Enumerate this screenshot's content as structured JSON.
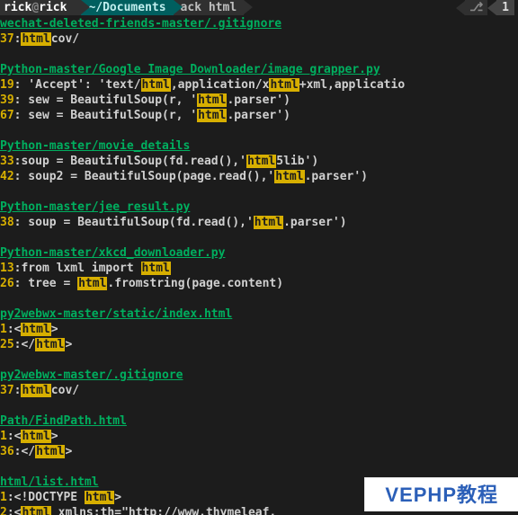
{
  "prompt": {
    "user": "rick",
    "at": "@",
    "host": "rick",
    "path": "~/Documents",
    "command": "ack html",
    "right_num": "1"
  },
  "groups": [
    {
      "file": "wechat-deleted-friends-master/.gitignore",
      "lines": [
        {
          "ln": "37",
          "pre": "",
          "hl": "html",
          "post": "cov/"
        }
      ]
    },
    {
      "file": "Python-master/Google Image Downloader/image grapper.py",
      "lines": [
        {
          "ln": "19",
          "segments": [
            "        'Accept': 'text/",
            {
              "hl": "html"
            },
            ",application/x",
            {
              "hl": "html"
            },
            "+xml,applicatio"
          ]
        },
        {
          "ln": "39",
          "segments": [
            "        sew = BeautifulSoup(r, '",
            {
              "hl": "html"
            },
            ".parser')"
          ]
        },
        {
          "ln": "67",
          "segments": [
            "        sew = BeautifulSoup(r, '",
            {
              "hl": "html"
            },
            ".parser')"
          ]
        }
      ]
    },
    {
      "file": "Python-master/movie_details",
      "lines": [
        {
          "ln": "33",
          "segments": [
            "soup = BeautifulSoup(fd.read(),'",
            {
              "hl": "html"
            },
            "5lib')"
          ]
        },
        {
          "ln": "42",
          "segments": [
            "    soup2 = BeautifulSoup(page.read(),'",
            {
              "hl": "html"
            },
            ".parser')"
          ]
        }
      ]
    },
    {
      "file": "Python-master/jee_result.py",
      "lines": [
        {
          "ln": "38",
          "segments": [
            "    soup = BeautifulSoup(fd.read(),'",
            {
              "hl": "html"
            },
            ".parser')"
          ]
        }
      ]
    },
    {
      "file": "Python-master/xkcd_downloader.py",
      "lines": [
        {
          "ln": "13",
          "segments": [
            "from lxml import ",
            {
              "hl": "html"
            }
          ]
        },
        {
          "ln": "26",
          "segments": [
            "    tree = ",
            {
              "hl": "html"
            },
            ".fromstring(page.content)"
          ]
        }
      ]
    },
    {
      "file": "py2webwx-master/static/index.html",
      "lines": [
        {
          "ln": "1",
          "segments": [
            "<",
            {
              "hl": "html"
            },
            ">"
          ]
        },
        {
          "ln": "25",
          "segments": [
            "</",
            {
              "hl": "html"
            },
            ">"
          ]
        }
      ]
    },
    {
      "file": "py2webwx-master/.gitignore",
      "lines": [
        {
          "ln": "37",
          "segments": [
            {
              "hl": "html"
            },
            "cov/"
          ]
        }
      ]
    },
    {
      "file": "Path/FindPath.html",
      "lines": [
        {
          "ln": "1",
          "segments": [
            "<",
            {
              "hl": "html"
            },
            ">"
          ]
        },
        {
          "ln": "36",
          "segments": [
            "</",
            {
              "hl": "html"
            },
            ">"
          ]
        }
      ]
    },
    {
      "file": "html/list.html",
      "lines": [
        {
          "ln": "1",
          "segments": [
            "<!DOCTYPE ",
            {
              "hl": "html"
            },
            ">"
          ]
        },
        {
          "ln": "2",
          "segments": [
            "<",
            {
              "hl": "html"
            },
            " xmlns:th=\"http://www.thymeleaf."
          ]
        }
      ]
    }
  ],
  "watermark": "VEPHP教程"
}
